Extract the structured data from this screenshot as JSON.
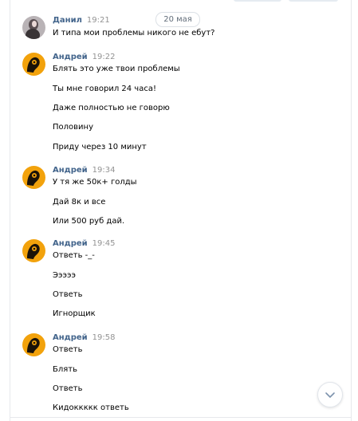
{
  "date_divider": "20 мая",
  "messages": [
    {
      "author": "Данил",
      "time": "19:21",
      "lines": [
        "И типа мои проблемы никого не ебут?"
      ]
    },
    {
      "author": "Андрей",
      "time": "19:22",
      "lines": [
        "Блять это уже твои проблемы",
        "Ты мне говорил 24 часа!",
        "Даже полностью не говорю",
        "Половину",
        "Приду через 10 минут"
      ]
    },
    {
      "author": "Андрей",
      "time": "19:34",
      "lines": [
        "У тя же 50к+ голды",
        "Дай 8к и все",
        "Или 500 руб дай."
      ]
    },
    {
      "author": "Андрей",
      "time": "19:45",
      "lines": [
        "Ответь -_-",
        "Эээээ",
        "Ответь",
        "Игнорщик"
      ]
    },
    {
      "author": "Андрей",
      "time": "19:58",
      "lines": [
        "Ответь",
        "Блять",
        "Ответь",
        "Кидоккккк ответь"
      ]
    }
  ],
  "colors": {
    "author": "#42648b",
    "time": "#939393",
    "avatar_andrey": "#f2a20c"
  },
  "icons": {
    "scroll_down": "chevron-down-icon"
  }
}
